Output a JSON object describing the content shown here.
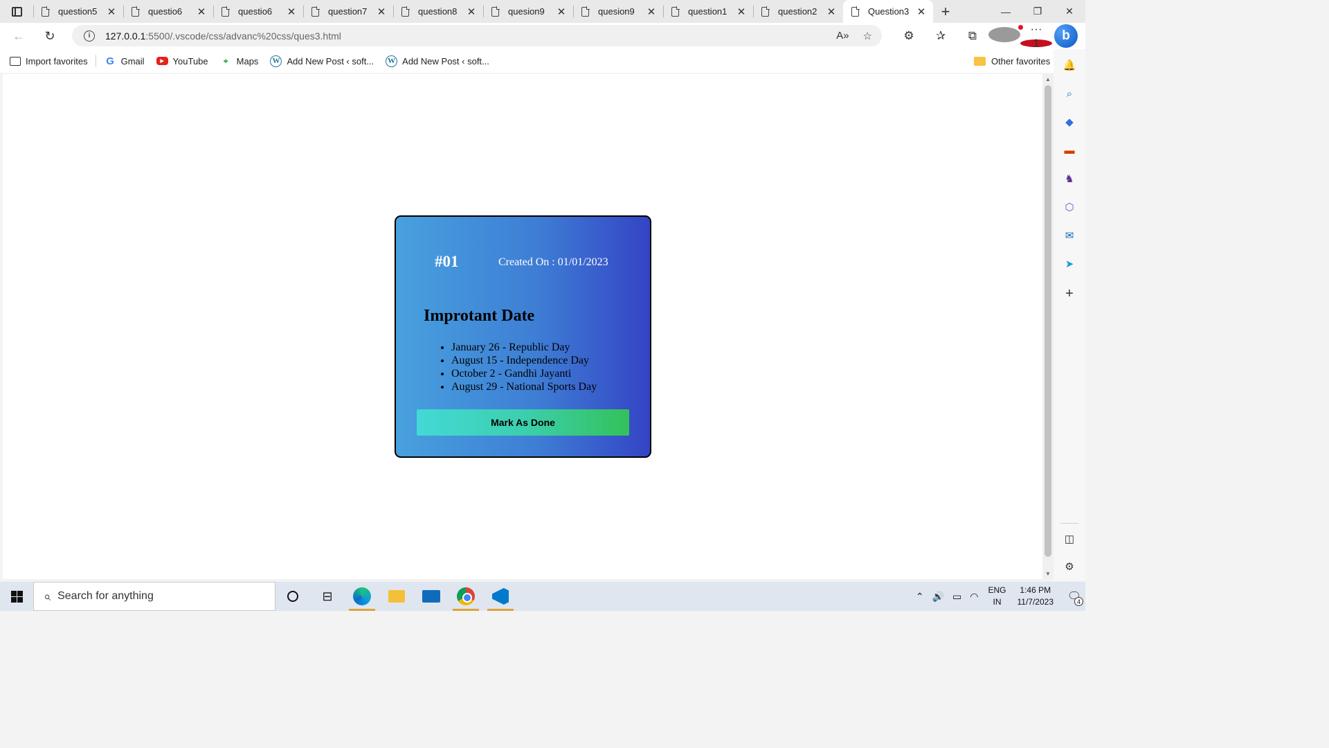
{
  "browser": {
    "tabs": [
      {
        "title": "question5",
        "active": false
      },
      {
        "title": "questio6",
        "active": false
      },
      {
        "title": "questio6",
        "active": false
      },
      {
        "title": "question7",
        "active": false
      },
      {
        "title": "question8",
        "active": false
      },
      {
        "title": "quesion9",
        "active": false
      },
      {
        "title": "quesion9",
        "active": false
      },
      {
        "title": "question1",
        "active": false
      },
      {
        "title": "question2",
        "active": false
      },
      {
        "title": "Question3",
        "active": true
      }
    ],
    "url_host": "127.0.0.1",
    "url_rest": ":5500/.vscode/css/advanc%20css/ques3.html",
    "notification_count": "1",
    "bing_label": "b",
    "favorites": [
      {
        "label": "Import favorites",
        "icon": "import-icon"
      },
      {
        "label": "Gmail",
        "icon": "google-icon"
      },
      {
        "label": "YouTube",
        "icon": "youtube-icon"
      },
      {
        "label": "Maps",
        "icon": "maps-icon"
      },
      {
        "label": "Add New Post ‹ soft...",
        "icon": "wordpress-icon"
      },
      {
        "label": "Add New Post ‹ soft...",
        "icon": "wordpress-icon"
      }
    ],
    "other_favorites": "Other favorites"
  },
  "card": {
    "id": "#01",
    "created": "Created On : 01/01/2023",
    "heading": "Improtant Date",
    "items": [
      "January 26 - Republic Day",
      "August 15 - Independence Day",
      "October 2 - Gandhi Jayanti",
      "August 29 - National Sports Day"
    ],
    "button": "Mark As Done"
  },
  "taskbar": {
    "search_placeholder": "Search for anything",
    "lang_top": "ENG",
    "lang_bottom": "IN",
    "time": "1:46 PM",
    "date": "11/7/2023",
    "notification_count": "4"
  },
  "colors": {
    "card_gradient_start": "#48a1de",
    "card_gradient_end": "#3444c4",
    "button_gradient_start": "#43d9d6",
    "button_gradient_end": "#33c15a"
  }
}
